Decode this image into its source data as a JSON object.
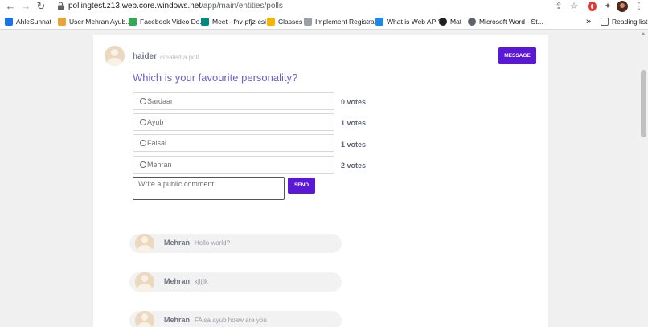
{
  "browser": {
    "url_host": "pollingtest.z13.web.core.windows.net",
    "url_path": "/app/main/entities/polls",
    "bookmarks": [
      {
        "label": "AhleSunnat -",
        "color": "#1a73e8"
      },
      {
        "label": "User Mehran Ayub...",
        "color": "#e8a33b"
      },
      {
        "label": "Facebook Video Do...",
        "color": "#34a853"
      },
      {
        "label": "Meet - fhv-pfjz-csi",
        "color": "#00897b"
      },
      {
        "label": "Classes",
        "color": "#f4b400"
      },
      {
        "label": "Implement Registra...",
        "color": "#5f6368"
      },
      {
        "label": "What is Web API?",
        "color": "#1e88e5"
      },
      {
        "label": "Mat",
        "color": "#202124"
      },
      {
        "label": "Microsoft Word - St...",
        "color": "#5f6368"
      }
    ],
    "more_bookmarks": "»",
    "reading_list": "Reading list"
  },
  "poll": {
    "author": "haider",
    "author_action": "created a poll",
    "message_button": "MESSAGE",
    "question": "Which is your favourite personality?",
    "options": [
      {
        "label": "Sardaar",
        "votes": "0 votes"
      },
      {
        "label": "Ayub",
        "votes": "1 votes"
      },
      {
        "label": "Faisal",
        "votes": "1 votes"
      },
      {
        "label": "Mehran",
        "votes": "2 votes"
      }
    ],
    "comment_placeholder": "Write a public comment",
    "send_button": "SEND"
  },
  "comments": [
    {
      "name": "Mehran",
      "text": "Hello world?"
    },
    {
      "name": "Mehran",
      "text": "kjljjlk"
    },
    {
      "name": "Mehran",
      "text": "FAisa ayub hoaw are you"
    }
  ],
  "colors": {
    "accent": "#5a17d6",
    "question": "#6a63c9"
  }
}
